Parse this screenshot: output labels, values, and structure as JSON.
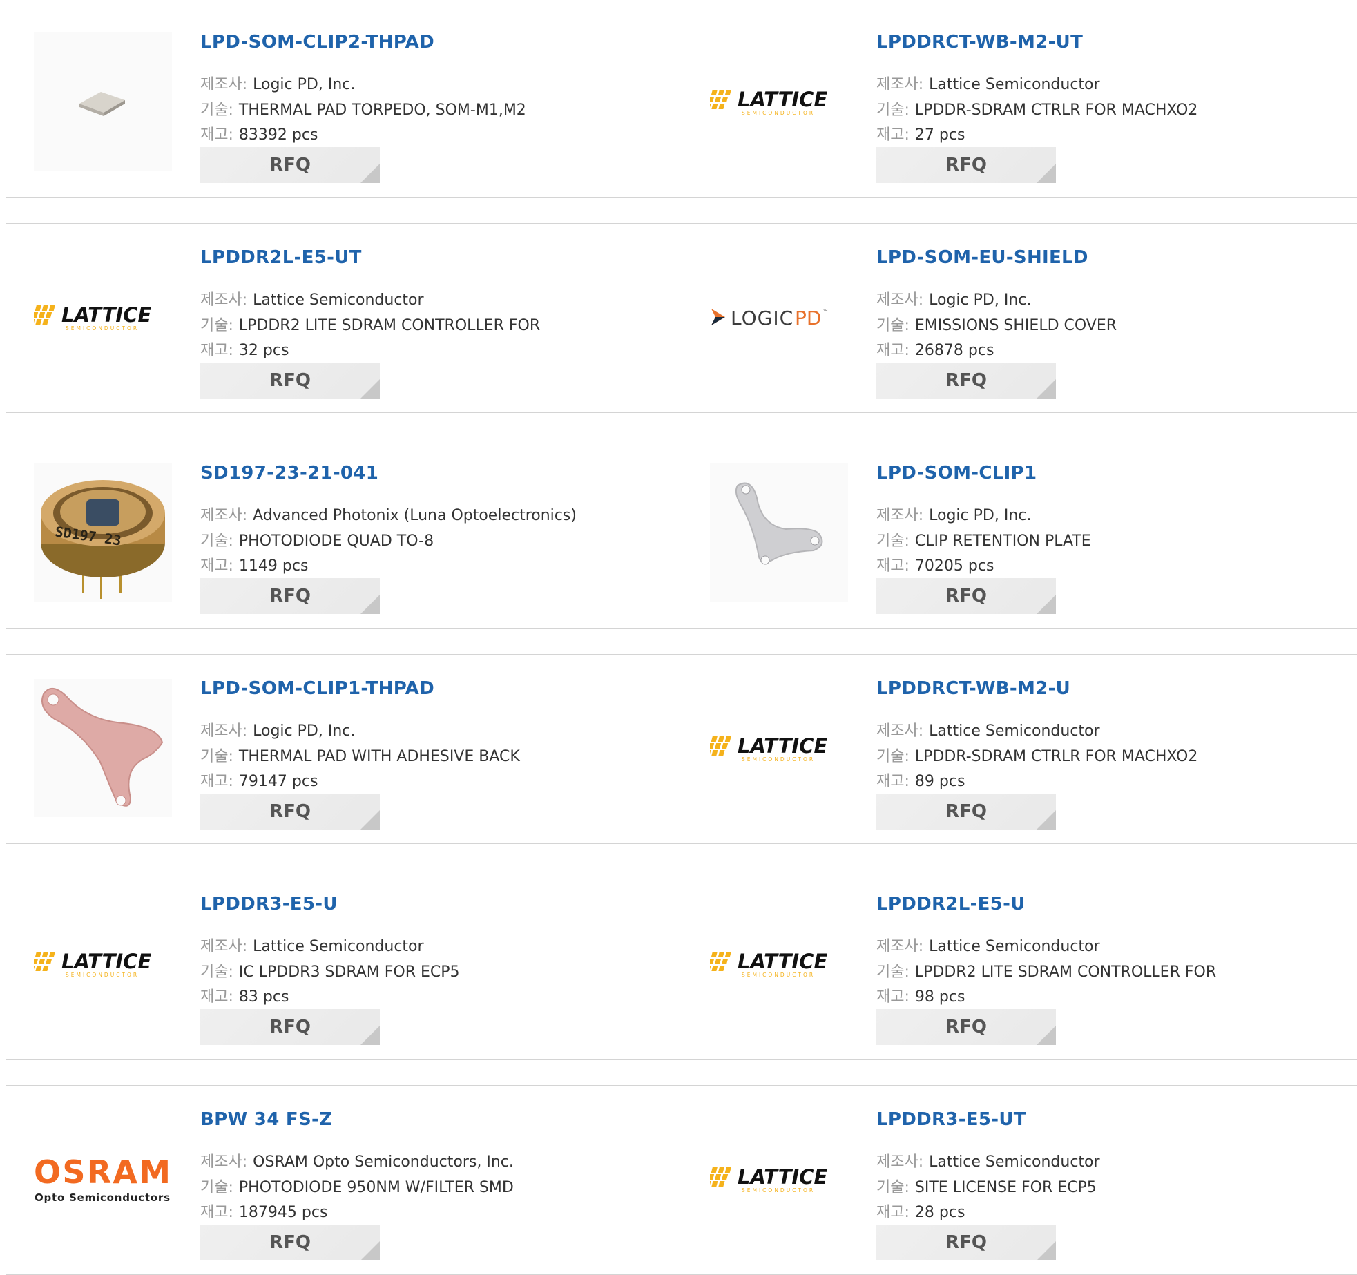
{
  "labels": {
    "manufacturer": "제조사:",
    "description": "기술:",
    "stock": "재고:"
  },
  "rfq_label": "RFQ",
  "products": [
    {
      "part": "LPD-SOM-CLIP2-THPAD",
      "manufacturer": "Logic PD, Inc.",
      "description": "THERMAL PAD TORPEDO, SOM-M1,M2",
      "stock": "83392 pcs",
      "image": "thermal-pad-image"
    },
    {
      "part": "LPDDRCT-WB-M2-UT",
      "manufacturer": "Lattice Semiconductor",
      "description": "LPDDR-SDRAM CTRLR FOR MACHXO2",
      "stock": "27 pcs",
      "image": "lattice-logo"
    },
    {
      "part": "LPDDR2L-E5-UT",
      "manufacturer": "Lattice Semiconductor",
      "description": "LPDDR2 LITE SDRAM CONTROLLER FOR",
      "stock": "32 pcs",
      "image": "lattice-logo"
    },
    {
      "part": "LPD-SOM-EU-SHIELD",
      "manufacturer": "Logic PD, Inc.",
      "description": "EMISSIONS SHIELD COVER",
      "stock": "26878 pcs",
      "image": "logicpd-logo"
    },
    {
      "part": "SD197-23-21-041",
      "manufacturer": "Advanced Photonix (Luna Optoelectronics)",
      "description": "PHOTODIODE QUAD TO-8",
      "stock": "1149 pcs",
      "image": "photodiode-image"
    },
    {
      "part": "LPD-SOM-CLIP1",
      "manufacturer": "Logic PD, Inc.",
      "description": "CLIP RETENTION PLATE",
      "stock": "70205 pcs",
      "image": "clip-plate-image"
    },
    {
      "part": "LPD-SOM-CLIP1-THPAD",
      "manufacturer": "Logic PD, Inc.",
      "description": "THERMAL PAD WITH ADHESIVE BACK",
      "stock": "79147 pcs",
      "image": "pink-pad-image"
    },
    {
      "part": "LPDDRCT-WB-M2-U",
      "manufacturer": "Lattice Semiconductor",
      "description": "LPDDR-SDRAM CTRLR FOR MACHXO2",
      "stock": "89 pcs",
      "image": "lattice-logo"
    },
    {
      "part": "LPDDR3-E5-U",
      "manufacturer": "Lattice Semiconductor",
      "description": "IC LPDDR3 SDRAM FOR ECP5",
      "stock": "83 pcs",
      "image": "lattice-logo"
    },
    {
      "part": "LPDDR2L-E5-U",
      "manufacturer": "Lattice Semiconductor",
      "description": "LPDDR2 LITE SDRAM CONTROLLER FOR",
      "stock": "98 pcs",
      "image": "lattice-logo"
    },
    {
      "part": "BPW 34 FS-Z",
      "manufacturer": "OSRAM Opto Semiconductors, Inc.",
      "description": "PHOTODIODE 950NM W/FILTER SMD",
      "stock": "187945 pcs",
      "image": "osram-logo"
    },
    {
      "part": "LPDDR3-E5-UT",
      "manufacturer": "Lattice Semiconductor",
      "description": "SITE LICENSE FOR ECP5",
      "stock": "28 pcs",
      "image": "lattice-logo"
    }
  ],
  "logos": {
    "lattice": {
      "word": "LATTICE",
      "sub": "SEMICONDUCTOR"
    },
    "logicpd": {
      "word1": "LOGIC",
      "word2": "PD",
      "tm": "™"
    },
    "osram": {
      "word": "OSRAM",
      "sub": "Opto Semiconductors"
    }
  },
  "colors": {
    "part_link": "#1f63ab",
    "label_gray": "#999999",
    "lattice_yellow": "#f5b21b",
    "osram_orange": "#f26a21"
  }
}
